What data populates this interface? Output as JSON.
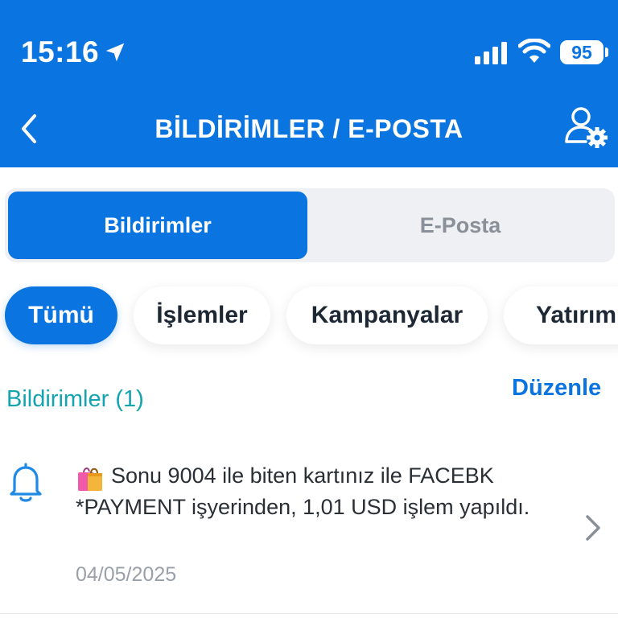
{
  "status_bar": {
    "time": "15:16",
    "battery": "95",
    "icons": [
      "location-arrow-icon",
      "signal-icon",
      "wifi-icon",
      "battery-icon"
    ]
  },
  "header": {
    "title": "BİLDİRİMLER / E-POSTA",
    "back_icon": "chevron-left-icon",
    "settings_icon": "user-gear-icon"
  },
  "tabs": [
    {
      "label": "Bildirimler",
      "active": true
    },
    {
      "label": "E-Posta",
      "active": false
    }
  ],
  "filters": [
    {
      "label": "Tümü",
      "active": true
    },
    {
      "label": "İşlemler",
      "active": false
    },
    {
      "label": "Kampanyalar",
      "active": false
    },
    {
      "label": "Yatırım",
      "active": false
    }
  ],
  "section": {
    "title": "Bildirimler (1)",
    "edit_label": "Düzenle"
  },
  "notifications": [
    {
      "icon": "bell-icon",
      "emoji": "shopping-bags-icon",
      "text": "Sonu 9004 ile biten kartınız ile FACEBK *PAYMENT işyerinden, 1,01 USD işlem yapıldı.",
      "date": "04/05/2025"
    }
  ],
  "colors": {
    "primary": "#0a74e0",
    "section_title": "#14a3b0",
    "segment_bg": "#eef0f3",
    "inactive_text": "#8a9099",
    "date_text": "#9aa0a8"
  }
}
